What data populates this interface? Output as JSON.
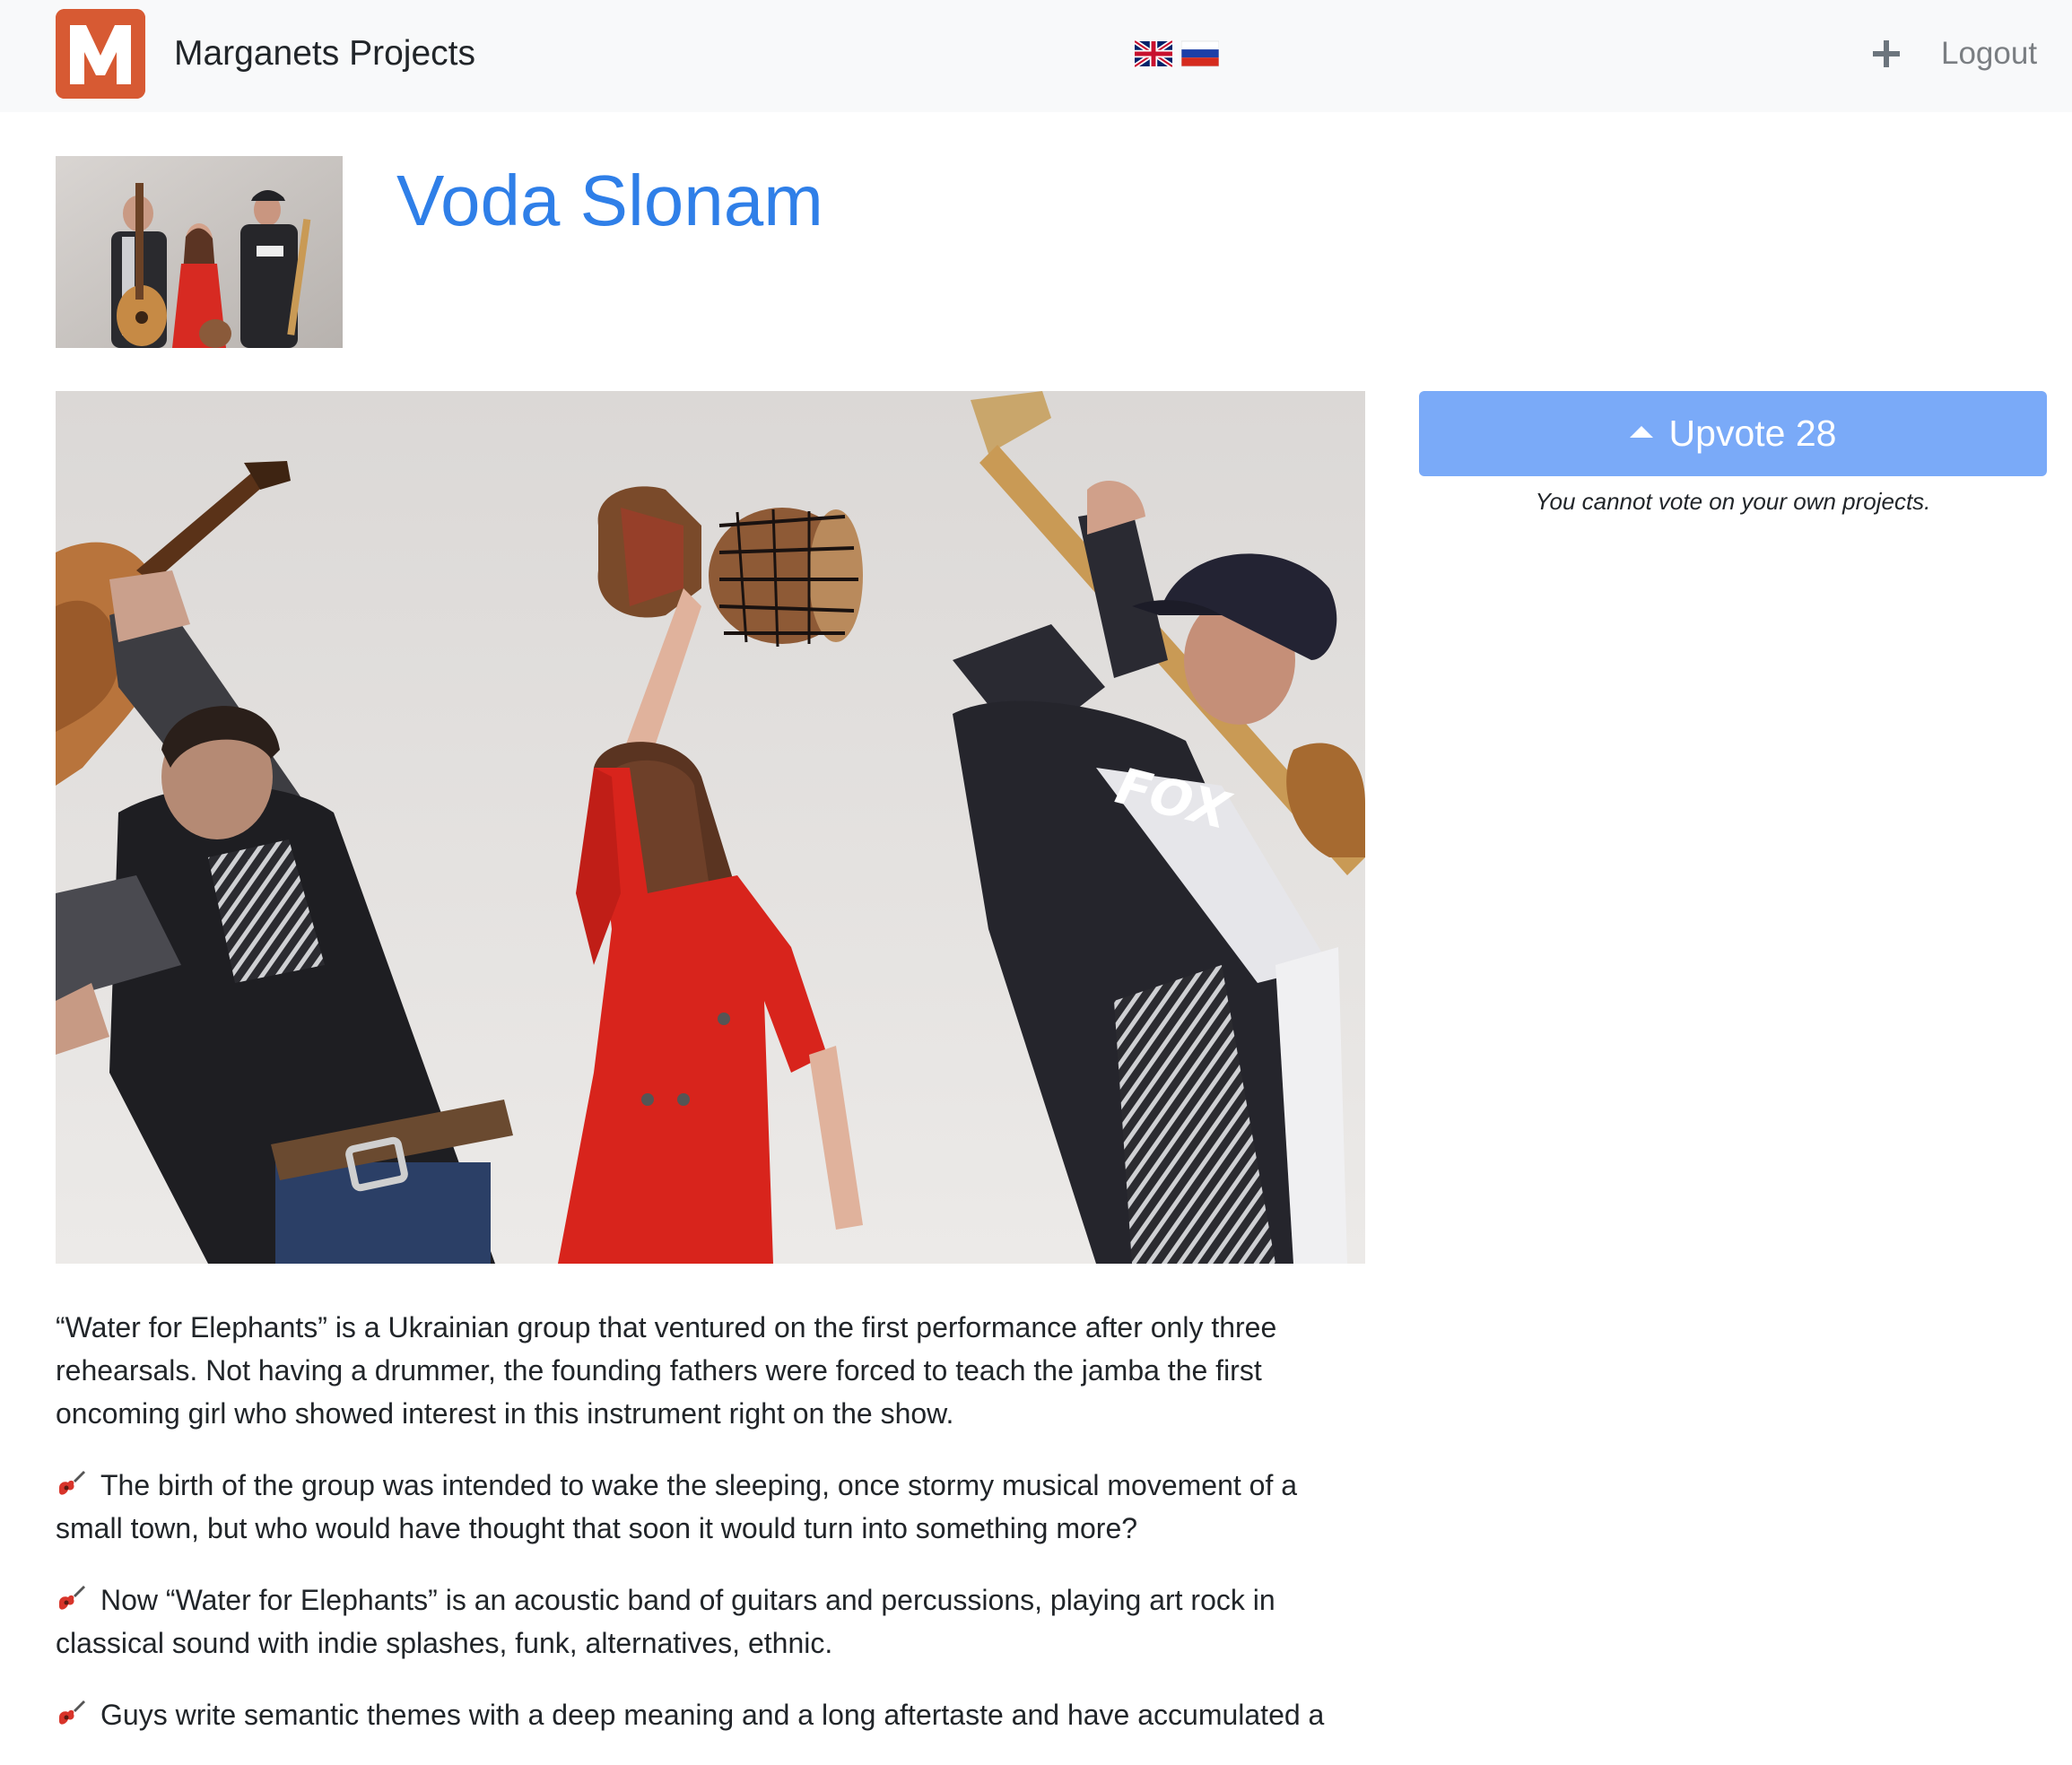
{
  "brand": {
    "logo_letter": "M",
    "name": "Marganets Projects"
  },
  "nav": {
    "language_flags": [
      "uk-flag-icon",
      "ru-flag-icon"
    ],
    "add_icon": "plus-icon",
    "logout_label": "Logout"
  },
  "project": {
    "title": "Voda Slonam",
    "upvote_label": "Upvote 28",
    "vote_note": "You cannot vote on your own projects.",
    "paragraphs": [
      "“Water for Elephants” is a Ukrainian group that ventured on the first performance after only three rehearsals. Not having a drummer, the founding fathers were forced to teach the jamba the first oncoming girl who showed interest in this instrument right on the show.",
      "The birth of the group was intended to wake the sleeping, once stormy musical movement of a small town, but who would have thought that soon it would turn into something more?",
      "Now “Water for Elephants” is an acoustic band of guitars and percussions, playing art rock in classical sound with indie splashes, funk, alternatives, ethnic.",
      "Guys write semantic themes with a deep meaning and a long aftertaste and have accumulated a"
    ],
    "paragraph_icon": "guitar-icon"
  },
  "colors": {
    "brand_orange": "#d75a33",
    "title_blue": "#2f7fe8",
    "upvote_blue": "#7aaaf8",
    "navbar_bg": "#f8f9fa"
  }
}
